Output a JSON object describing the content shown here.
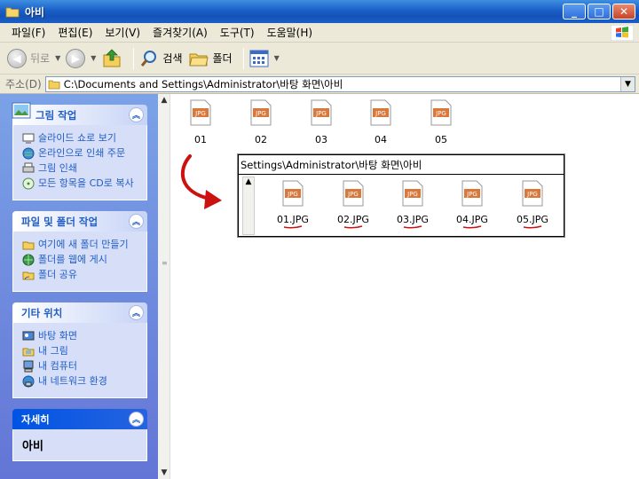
{
  "window": {
    "title": "아비"
  },
  "menu": [
    "파일(F)",
    "편집(E)",
    "보기(V)",
    "즐겨찾기(A)",
    "도구(T)",
    "도움말(H)"
  ],
  "toolbar": {
    "back": "뒤로",
    "search": "검색",
    "folders": "폴더"
  },
  "address": {
    "label": "주소(D)",
    "path": "C:\\Documents and Settings\\Administrator\\바탕 화면\\아비"
  },
  "panels": [
    {
      "title": "그림 작업",
      "style": "light",
      "items": [
        {
          "icon": "slideshow-icon",
          "label": "슬라이드 쇼로 보기"
        },
        {
          "icon": "online-print-icon",
          "label": "온라인으로 인쇄 주문"
        },
        {
          "icon": "printer-icon",
          "label": "그림 인쇄"
        },
        {
          "icon": "cd-copy-icon",
          "label": "모든 항목을 CD로 복사"
        }
      ]
    },
    {
      "title": "파일 및 폴더 작업",
      "style": "light",
      "items": [
        {
          "icon": "new-folder-icon",
          "label": "여기에 새 폴더 만들기"
        },
        {
          "icon": "web-publish-icon",
          "label": "폴더를 웹에 게시"
        },
        {
          "icon": "share-folder-icon",
          "label": "폴더 공유"
        }
      ]
    },
    {
      "title": "기타 위치",
      "style": "light",
      "items": [
        {
          "icon": "desktop-icon",
          "label": "바탕 화면"
        },
        {
          "icon": "my-pictures-icon",
          "label": "내 그림"
        },
        {
          "icon": "my-computer-icon",
          "label": "내 컴퓨터"
        },
        {
          "icon": "network-icon",
          "label": "내 네트워크 환경"
        }
      ]
    },
    {
      "title": "자세히",
      "style": "dark",
      "detail": "아비"
    }
  ],
  "files": [
    "01",
    "02",
    "03",
    "04",
    "05"
  ],
  "inset": {
    "path": "Settings\\Administrator\\바탕 화면\\아비",
    "files": [
      "01.JPG",
      "02.JPG",
      "03.JPG",
      "04.JPG",
      "05.JPG"
    ]
  },
  "colors": {
    "accent": "#cc1111",
    "link": "#215dc6",
    "titlebar": "#1a5fc7"
  }
}
